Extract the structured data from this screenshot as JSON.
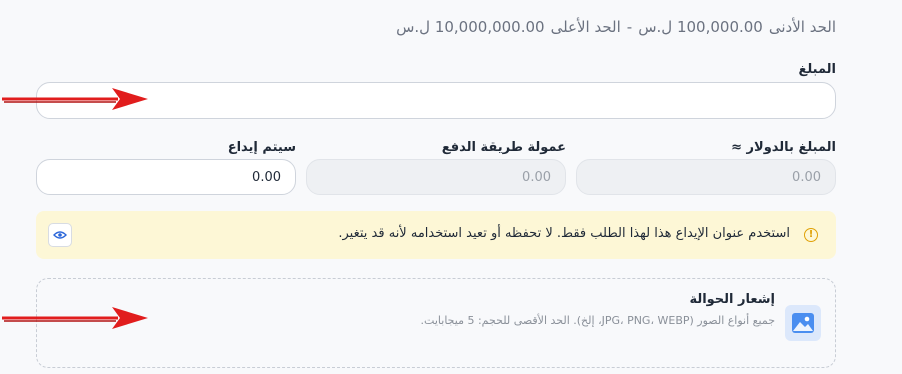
{
  "limits": {
    "min_label": "الحد الأدنى",
    "min_value": "100,000.00 ل.س",
    "separator": "-",
    "max_label": "الحد الأعلى",
    "max_value": "10,000,000.00 ل.س"
  },
  "amount": {
    "label": "المبلغ",
    "value": ""
  },
  "usd_amount": {
    "label": "المبلغ بالدولار ≈",
    "value": "0.00"
  },
  "fee": {
    "label": "عمولة طريقة الدفع",
    "value": "0.00"
  },
  "deposit": {
    "label": "سيتم إيداع",
    "value": "0.00"
  },
  "notice": {
    "text": "استخدم عنوان الإيداع هذا لهذا الطلب فقط. لا تحفظه أو تعيد استخدامه لأنه قد يتغير.",
    "icon": "warning-icon"
  },
  "upload": {
    "title": "إشعار الحوالة",
    "hint": "جميع أنواع الصور (JPG، PNG، WEBP، إلخ). الحد الأقصى للحجم: 5 ميجابايت."
  },
  "colors": {
    "accent": "#4a8ef0",
    "annotation_arrow": "#e11d1d",
    "notice_bg": "#fdf7d6"
  }
}
